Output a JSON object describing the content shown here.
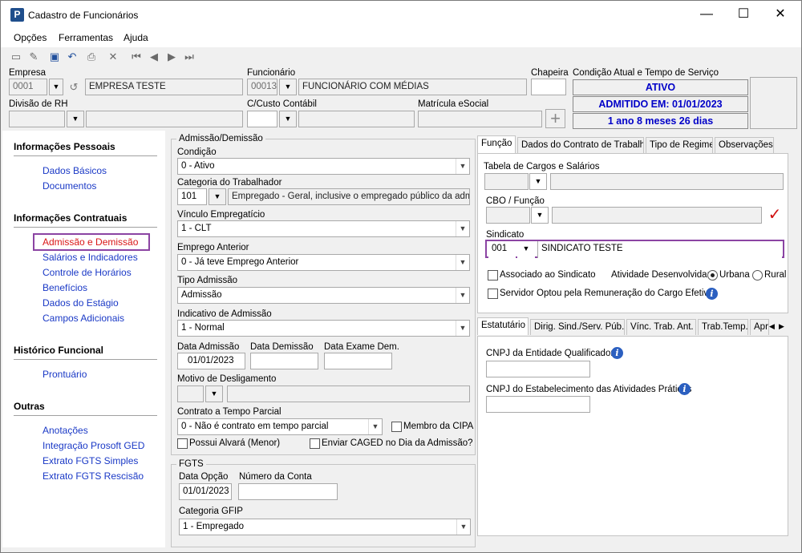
{
  "window": {
    "title": "Cadastro de Funcionários",
    "minimize": "—",
    "maximize": "☐",
    "close": "✕"
  },
  "menu": [
    {
      "label": "Opções"
    },
    {
      "label": "Ferramentas"
    },
    {
      "label": "Ajuda"
    }
  ],
  "header": {
    "empresa_label": "Empresa",
    "empresa_code": "0001",
    "empresa_name": "EMPRESA TESTE",
    "funcionario_label": "Funcionário",
    "funcionario_code": "00013",
    "funcionario_name": "FUNCIONÁRIO COM MÉDIAS",
    "chapeira_label": "Chapeira",
    "chapeira_value": "",
    "condicao_label": "Condição Atual e Tempo de Serviço",
    "status_ativo": "ATIVO",
    "status_admitido": "ADMITIDO EM: 01/01/2023",
    "status_tempo": "1 ano 8 meses 26 dias",
    "divisao_label": "Divisão de RH",
    "ccusto_label": "C/Custo Contábil",
    "matricula_label": "Matrícula eSocial"
  },
  "sidebar": {
    "sections": [
      {
        "title": "Informações Pessoais",
        "items": [
          "Dados Básicos",
          "Documentos"
        ]
      },
      {
        "title": "Informações Contratuais",
        "items": [
          "Admissão e Demissão",
          "Salários e Indicadores",
          "Controle de Horários",
          "Benefícios",
          "Dados do Estágio",
          "Campos Adicionais"
        ]
      },
      {
        "title": "Histórico Funcional",
        "items": [
          "Prontuário"
        ]
      },
      {
        "title": "Outras",
        "items": [
          "Anotações",
          "Integração Prosoft GED",
          "Extrato FGTS Simples",
          "Extrato FGTS Rescisão"
        ]
      }
    ],
    "selected": "Admissão e Demissão"
  },
  "admissao": {
    "group_title": "Admissão/Demissão",
    "condicao_label": "Condição",
    "condicao_value": "0 - Ativo",
    "categoria_label": "Categoria do Trabalhador",
    "categoria_code": "101",
    "categoria_desc": "Empregado - Geral, inclusive o empregado público da administ",
    "vinculo_label": "Vínculo Empregatício",
    "vinculo_value": "1 - CLT",
    "emprego_label": "Emprego Anterior",
    "emprego_value": "0 - Já teve Emprego Anterior",
    "tipo_label": "Tipo Admissão",
    "tipo_value": "Admissão",
    "indicativo_label": "Indicativo de Admissão",
    "indicativo_value": "1 - Normal",
    "data_adm_label": "Data Admissão",
    "data_adm_value": "01/01/2023",
    "data_dem_label": "Data Demissão",
    "data_dem_value": "",
    "data_exame_label": "Data Exame Dem.",
    "data_exame_value": "",
    "motivo_label": "Motivo de Desligamento",
    "contrato_label": "Contrato a Tempo Parcial",
    "contrato_value": "0 - Não é contrato em tempo parcial",
    "membro_cipa": "Membro da CIPA",
    "alvara": "Possui Alvará (Menor)",
    "caged": "Enviar CAGED no Dia da Admissão?"
  },
  "fgts": {
    "group_title": "FGTS",
    "data_opcao_label": "Data Opção",
    "data_opcao_value": "01/01/2023",
    "conta_label": "Número da Conta",
    "conta_value": "",
    "categoria_label": "Categoria GFIP",
    "categoria_value": "1 - Empregado"
  },
  "right_tabs": [
    "Função",
    "Dados do Contrato de Trabalho",
    "Tipo de Regime",
    "Observações"
  ],
  "funcao": {
    "tabela_label": "Tabela de Cargos e Salários",
    "cbo_label": "CBO / Função",
    "sindicato_label": "Sindicato",
    "sindicato_code": "001",
    "sindicato_name": "SINDICATO TESTE",
    "associado": "Associado ao Sindicato",
    "atividade_label": "Atividade Desenvolvida:",
    "urbana": "Urbana",
    "rural": "Rural",
    "servidor": "Servidor Optou pela Remuneração do Cargo Efetivo"
  },
  "lower_tabs": [
    "Estatutário",
    "Dirig. Sind./Serv. Púb.",
    "Vínc. Trab. Ant.",
    "Trab.Temp.",
    "Apr"
  ],
  "estatutario": {
    "cnpj_ent_label": "CNPJ da Entidade Qualificadora",
    "cnpj_est_label": "CNPJ do Estabelecimento das Atividades Práticas"
  },
  "colors": {
    "link": "#1a39c6",
    "selected": "#d91616",
    "highlight": "#8b44a3",
    "status_text": "#0000c8"
  }
}
